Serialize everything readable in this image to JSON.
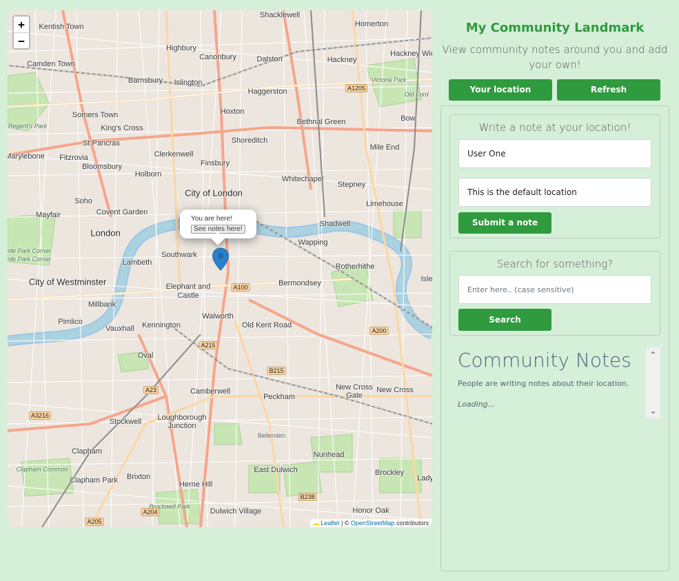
{
  "map": {
    "zoom_in": "+",
    "zoom_out": "−",
    "labels": [
      {
        "t": "Kentish Town",
        "c": ""
      },
      {
        "t": "Highbury",
        "c": ""
      },
      {
        "t": "Shacklewell",
        "c": ""
      },
      {
        "t": "Homerton",
        "c": ""
      },
      {
        "t": "Camden Town",
        "c": ""
      },
      {
        "t": "Canonbury",
        "c": ""
      },
      {
        "t": "Dalston",
        "c": ""
      },
      {
        "t": "Hackney",
        "c": ""
      },
      {
        "t": "Hackney Wick",
        "c": ""
      },
      {
        "t": "Barnsbury",
        "c": ""
      },
      {
        "t": "Islington",
        "c": ""
      },
      {
        "t": "Haggerston",
        "c": ""
      },
      {
        "t": "Victoria Park",
        "c": "italic"
      },
      {
        "t": "Old Ford",
        "c": "italic"
      },
      {
        "t": "Somers Town",
        "c": ""
      },
      {
        "t": "Hoxton",
        "c": ""
      },
      {
        "t": "The Regent's Park",
        "c": "italic"
      },
      {
        "t": "King's Cross",
        "c": ""
      },
      {
        "t": "Bethnal Green",
        "c": ""
      },
      {
        "t": "Bow",
        "c": ""
      },
      {
        "t": "St Pancras",
        "c": ""
      },
      {
        "t": "Shoreditch",
        "c": ""
      },
      {
        "t": "Mile End",
        "c": ""
      },
      {
        "t": "Marylebone",
        "c": ""
      },
      {
        "t": "Fitzrovia",
        "c": ""
      },
      {
        "t": "Clerkenwell",
        "c": ""
      },
      {
        "t": "Bloomsbury",
        "c": ""
      },
      {
        "t": "Finsbury",
        "c": ""
      },
      {
        "t": "Holborn",
        "c": ""
      },
      {
        "t": "Whitechapel",
        "c": ""
      },
      {
        "t": "Stepney",
        "c": ""
      },
      {
        "t": "Soho",
        "c": ""
      },
      {
        "t": "City of London",
        "c": "big"
      },
      {
        "t": "Limehouse",
        "c": ""
      },
      {
        "t": "Mayfair",
        "c": ""
      },
      {
        "t": "Covent Garden",
        "c": ""
      },
      {
        "t": "Shadwell",
        "c": ""
      },
      {
        "t": "London",
        "c": "big"
      },
      {
        "t": "Wapping",
        "c": ""
      },
      {
        "t": "Hyde Park Corner",
        "c": "italic"
      },
      {
        "t": "Hyde Park Corner",
        "c": "italic"
      },
      {
        "t": "Southwark",
        "c": ""
      },
      {
        "t": "Lambeth",
        "c": ""
      },
      {
        "t": "Rotherhithe",
        "c": ""
      },
      {
        "t": "City of Westminster",
        "c": "big"
      },
      {
        "t": "Bermondsey",
        "c": ""
      },
      {
        "t": "Elephant and",
        "c": ""
      },
      {
        "t": "Castle",
        "c": ""
      },
      {
        "t": "Millbank",
        "c": ""
      },
      {
        "t": "Isle",
        "c": ""
      },
      {
        "t": "Walworth",
        "c": ""
      },
      {
        "t": "Pimlico",
        "c": ""
      },
      {
        "t": "Kennington",
        "c": ""
      },
      {
        "t": "Old Kent Road",
        "c": ""
      },
      {
        "t": "Vauxhall",
        "c": ""
      },
      {
        "t": "Oval",
        "c": ""
      },
      {
        "t": "Camberwell",
        "c": ""
      },
      {
        "t": "New Cross",
        "c": ""
      },
      {
        "t": "Gate",
        "c": ""
      },
      {
        "t": "New Cross",
        "c": ""
      },
      {
        "t": "Peckham",
        "c": ""
      },
      {
        "t": "Stockwell",
        "c": ""
      },
      {
        "t": "Loughborough",
        "c": ""
      },
      {
        "t": "Junction",
        "c": ""
      },
      {
        "t": "Bellenden",
        "c": "small"
      },
      {
        "t": "Clapham",
        "c": ""
      },
      {
        "t": "Nunhead",
        "c": ""
      },
      {
        "t": "Clapham Common",
        "c": "italic"
      },
      {
        "t": "East Dulwich",
        "c": ""
      },
      {
        "t": "Brockley",
        "c": ""
      },
      {
        "t": "Clapham Park",
        "c": ""
      },
      {
        "t": "Brixton",
        "c": ""
      },
      {
        "t": "Herne Hill",
        "c": ""
      },
      {
        "t": "Lady",
        "c": ""
      },
      {
        "t": "Brockwell Park",
        "c": "italic"
      },
      {
        "t": "Dulwich Village",
        "c": ""
      },
      {
        "t": "Honor Oak",
        "c": ""
      },
      {
        "t": "A1205",
        "c": "road"
      },
      {
        "t": "A100",
        "c": "road"
      },
      {
        "t": "A200",
        "c": "road"
      },
      {
        "t": "A215",
        "c": "road"
      },
      {
        "t": "B215",
        "c": "road"
      },
      {
        "t": "A23",
        "c": "road"
      },
      {
        "t": "A3216",
        "c": "road"
      },
      {
        "t": "B238",
        "c": "road"
      },
      {
        "t": "A204",
        "c": "road"
      },
      {
        "t": "A205",
        "c": "road"
      }
    ],
    "popup": {
      "line1": "You are here!",
      "button": "See notes here!"
    },
    "attribution": {
      "flag": "▬",
      "leaflet": "Leaflet",
      "sep": " | © ",
      "osm": "OpenStreetMap",
      "rest": " contributors"
    }
  },
  "header": {
    "title": "My Community Landmark",
    "subtitle": "View community notes around you and add your own!",
    "location_button": "Your location",
    "refresh_button": "Refresh"
  },
  "note_form": {
    "title": "Write a note at your location!",
    "name_value": "User One",
    "note_value": "This is the default location",
    "submit_button": "Submit a note"
  },
  "search_form": {
    "title": "Search for something?",
    "placeholder": "Enter here.. (case sensitive)",
    "search_button": "Search"
  },
  "notes": {
    "title": "Community Notes",
    "subtitle": "People are writing notes about their location.",
    "status": "Loading..."
  },
  "colors": {
    "accent": "#2f9a3e",
    "background": "#d6efd9",
    "muted_text": "#4d6675"
  }
}
